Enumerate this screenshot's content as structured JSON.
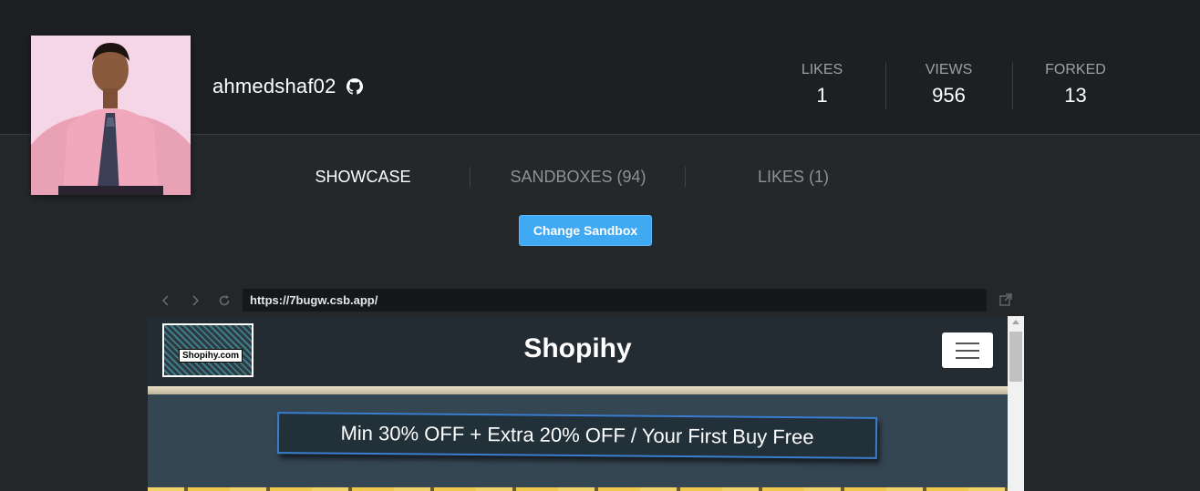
{
  "profile": {
    "username": "ahmedshaf02",
    "github_icon": "github-icon",
    "avatar_icon": "user-avatar-photo"
  },
  "stats": [
    {
      "label": "LIKES",
      "value": "1"
    },
    {
      "label": "VIEWS",
      "value": "956"
    },
    {
      "label": "FORKED",
      "value": "13"
    }
  ],
  "tabs": [
    {
      "label": "SHOWCASE",
      "active": true
    },
    {
      "label": "SANDBOXES (94)",
      "active": false
    },
    {
      "label": "LIKES (1)",
      "active": false
    }
  ],
  "change_sandbox_label": "Change Sandbox",
  "browser": {
    "url": "https://7bugw.csb.app/",
    "back_icon": "chevron-left-icon",
    "forward_icon": "chevron-right-icon",
    "reload_icon": "reload-icon",
    "open_external_icon": "open-external-icon"
  },
  "site": {
    "logo_text": "Shopihy.com",
    "title": "Shopihy",
    "menu_icon": "hamburger-menu-icon",
    "promo": "Min 30% OFF + Extra 20% OFF / Your First Buy Free"
  },
  "colors": {
    "accent": "#40a9f3",
    "header_bg": "#1c2022",
    "page_bg": "#24282a",
    "site_nav_bg": "#232b33",
    "promo_border": "#3a7ecf"
  }
}
